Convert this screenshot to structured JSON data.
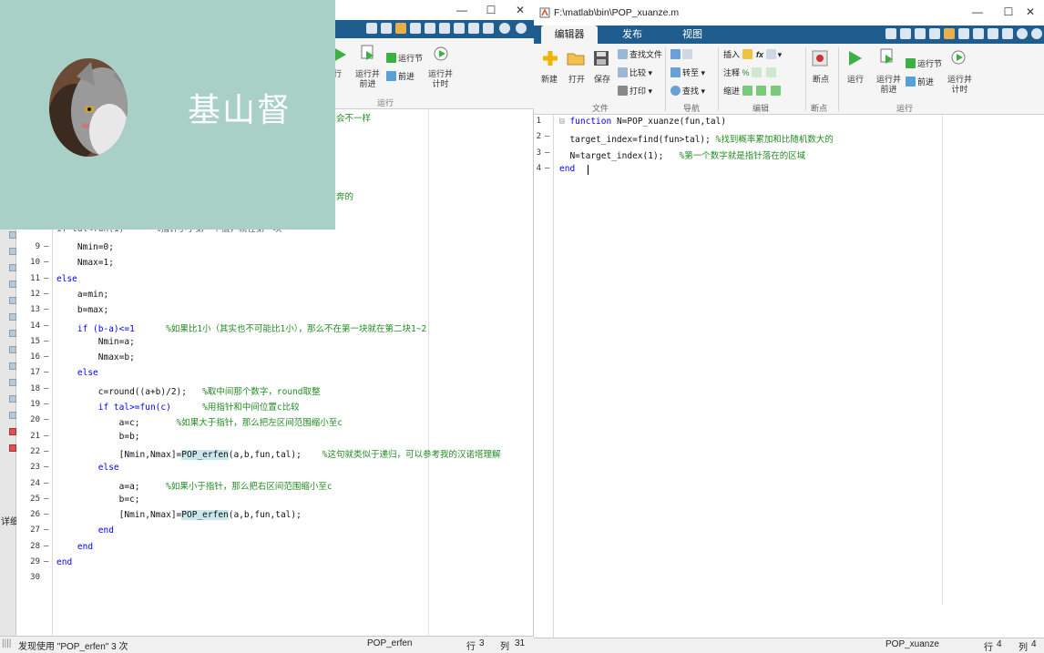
{
  "left_editor": {
    "window_controls": {
      "minimize": "—",
      "maximize": "☐",
      "close": "✕"
    },
    "ribbon": {
      "run_label": "行",
      "run_advance_label": "运行并\n前进",
      "run_section_label": "运行节",
      "advance_label": "前进",
      "run_time_label": "运行并\n计时",
      "group_run_label": "运行"
    },
    "code_lines": [
      {
        "n": "9",
        "text": "    Nmin=0;"
      },
      {
        "n": "10",
        "text": "    Nmax=1;"
      },
      {
        "n": "11",
        "text": "else"
      },
      {
        "n": "12",
        "text": "    a=min;"
      },
      {
        "n": "13",
        "text": "    b=max;"
      },
      {
        "n": "14",
        "code": "    if (b-a)<=1      ",
        "comment": "%如果比1小（其实也不可能比1小），那么不在第一块就在第二块1~2"
      },
      {
        "n": "15",
        "text": "        Nmin=a;"
      },
      {
        "n": "16",
        "text": "        Nmax=b;"
      },
      {
        "n": "17",
        "text": "    else"
      },
      {
        "n": "18",
        "code": "        c=round((a+b)/2);   ",
        "comment": "%取中间那个数字，round取整"
      },
      {
        "n": "19",
        "code": "        if tal>=fun(c)      ",
        "comment": "%用指针和中间位置c比较"
      },
      {
        "n": "20",
        "code": "            a=c;       ",
        "comment": "%如果大于指针，那么把左区间范围缩小至c"
      },
      {
        "n": "21",
        "text": "            b=b;"
      },
      {
        "n": "22",
        "pre": "            [Nmin,Nmax]=",
        "fn": "POP_erfen",
        "post": "(a,b,fun,tal);    ",
        "comment": "%这句就类似于递归，可以参考我的汉诺塔理解"
      },
      {
        "n": "23",
        "text": "        else"
      },
      {
        "n": "24",
        "code": "            a=a;     ",
        "comment": "%如果小于指针，那么把右区间范围缩小至c"
      },
      {
        "n": "25",
        "text": "            b=c;"
      },
      {
        "n": "26",
        "pre": "            [Nmin,Nmax]=",
        "fn": "POP_erfen",
        "post": "(a,b,fun,tal);",
        "comment": ""
      },
      {
        "n": "27",
        "text": "        end"
      },
      {
        "n": "28",
        "text": "    end"
      },
      {
        "n": "29",
        "text": "end"
      },
      {
        "n": "30",
        "text": ""
      }
    ],
    "partial_comments": {
      "line_top": "会不一样",
      "line_mid": "奔的"
    },
    "partial_code_line_8": "if tal<fun(1)      %指针小于第一个值，就在第一块",
    "status": {
      "found_text": "发现使用 \"POP_erfen\" 3 次",
      "function_name": "POP_erfen",
      "row_label": "行",
      "row_value": "3",
      "col_label": "列",
      "col_value": "31"
    },
    "side_label": "详细"
  },
  "overlay": {
    "signature": "基山督"
  },
  "right_editor": {
    "title": "F:\\matlab\\bin\\POP_xuanze.m",
    "window_controls": {
      "minimize": "—",
      "maximize": "☐",
      "close": "✕"
    },
    "tabs": [
      {
        "label": "编辑器",
        "active": true
      },
      {
        "label": "发布",
        "active": false
      },
      {
        "label": "视图",
        "active": false
      }
    ],
    "ribbon": {
      "file": {
        "new": "新建",
        "open": "打开",
        "save": "保存",
        "find_file": "查找文件",
        "compare": "比较",
        "print": "打印",
        "group": "文件"
      },
      "navigate": {
        "goto": "转至",
        "find": "查找",
        "group": "导航"
      },
      "edit": {
        "insert": "插入",
        "comment": "注释",
        "indent": "缩进",
        "group": "编辑"
      },
      "breakpoints": {
        "label": "断点",
        "group": "断点"
      },
      "run": {
        "run": "运行",
        "run_advance": "运行并\n前进",
        "run_section": "运行节",
        "advance": "前进",
        "run_time": "运行并\n计时",
        "group": "运行"
      }
    },
    "code_lines": [
      {
        "n": "1",
        "dash": "",
        "kw": "function",
        "rest": " N=POP_xuanze(fun,tal)",
        "comment": ""
      },
      {
        "n": "2",
        "dash": "—",
        "kw": "",
        "rest": "  target_index=find(fun>tal); ",
        "comment": "%找到概率累加和比随机数大的"
      },
      {
        "n": "3",
        "dash": "—",
        "kw": "",
        "rest": "  N=target_index(1);   ",
        "comment": "%第一个数字就是指针落在的区域"
      },
      {
        "n": "4",
        "dash": "—",
        "kw": "end",
        "rest": "",
        "comment": ""
      }
    ],
    "status": {
      "function_name": "POP_xuanze",
      "row_label": "行",
      "row_value": "4",
      "col_label": "列",
      "col_value": "4"
    }
  }
}
